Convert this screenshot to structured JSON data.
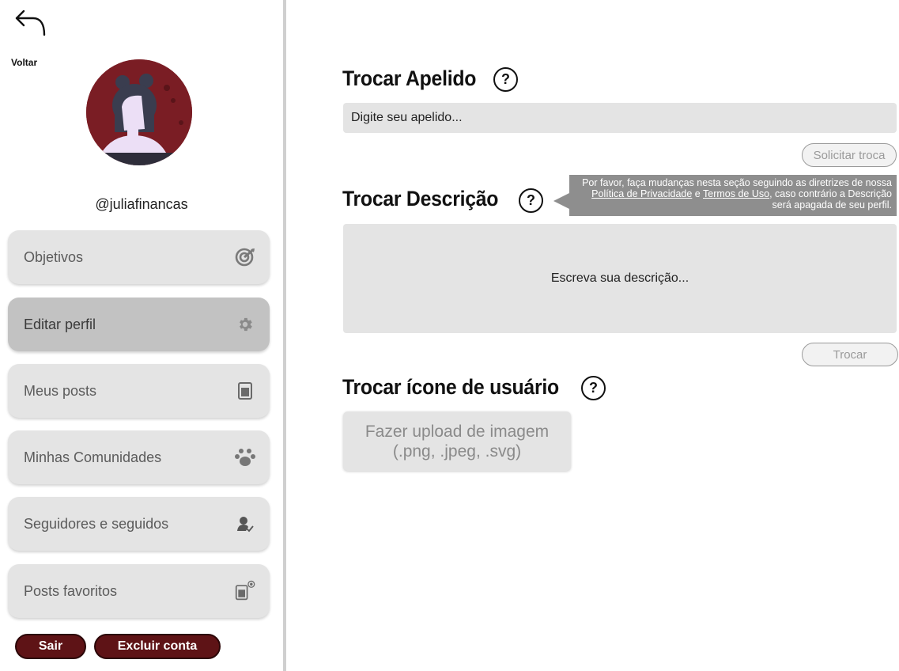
{
  "sidebar": {
    "back_label": "Voltar",
    "handle": "@juliafinancas",
    "items": [
      {
        "label": "Objetivos",
        "icon": "target-icon"
      },
      {
        "label": "Editar perfil",
        "icon": "gear-icon"
      },
      {
        "label": "Meus posts",
        "icon": "document-icon"
      },
      {
        "label": "Minhas Comunidades",
        "icon": "paw-icon"
      },
      {
        "label": "Seguidores e seguidos",
        "icon": "user-check-icon"
      },
      {
        "label": "Posts favoritos",
        "icon": "document-plus-icon"
      }
    ],
    "logout_label": "Sair",
    "delete_label": "Excluir conta"
  },
  "main": {
    "nickname": {
      "title": "Trocar Apelido",
      "placeholder": "Digite seu apelido...",
      "button": "Solicitar troca"
    },
    "description": {
      "title": "Trocar Descrição",
      "placeholder": "Escreva sua descrição...",
      "button": "Trocar",
      "tooltip": {
        "part1": "Por favor, faça mudanças nesta seção seguindo as diretrizes de nossa ",
        "link1": "Política de Privacidade",
        "part2": " e ",
        "link2": "Termos de Uso",
        "part3": ", caso contrário a Descrição será apagada de seu perfil."
      }
    },
    "icon": {
      "title": "Trocar ícone de usuário",
      "upload_line1": "Fazer upload de imagem",
      "upload_line2": "(.png, .jpeg, .svg)"
    },
    "help_glyph": "?"
  },
  "colors": {
    "accent_dark_red": "#5e1316",
    "avatar_bg": "#7a1d24",
    "panel_gray": "#e4e4e4",
    "active_gray": "#c2c2c2",
    "tooltip_gray": "#8e8e8e"
  }
}
